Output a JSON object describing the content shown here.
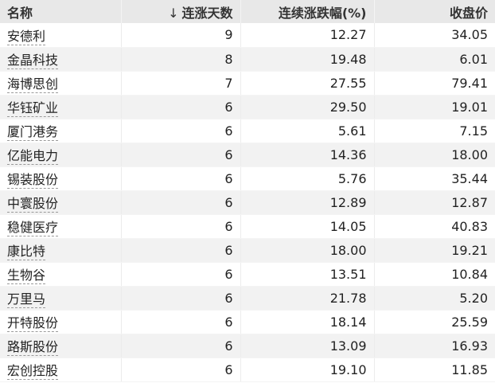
{
  "table": {
    "headers": {
      "name": "名称",
      "days_arrow": "↓",
      "days": "连涨天数",
      "pct": "连续涨跌幅(%)",
      "close": "收盘价"
    },
    "rows": [
      {
        "name": "安德利",
        "days": "9",
        "pct": "12.27",
        "close": "34.05"
      },
      {
        "name": "金晶科技",
        "days": "8",
        "pct": "19.48",
        "close": "6.01"
      },
      {
        "name": "海博思创",
        "days": "7",
        "pct": "27.55",
        "close": "79.41"
      },
      {
        "name": "华钰矿业",
        "days": "6",
        "pct": "29.50",
        "close": "19.01"
      },
      {
        "name": "厦门港务",
        "days": "6",
        "pct": "5.61",
        "close": "7.15"
      },
      {
        "name": "亿能电力",
        "days": "6",
        "pct": "14.36",
        "close": "18.00"
      },
      {
        "name": "锡装股份",
        "days": "6",
        "pct": "5.76",
        "close": "35.44"
      },
      {
        "name": "中寰股份",
        "days": "6",
        "pct": "12.89",
        "close": "12.87"
      },
      {
        "name": "稳健医疗",
        "days": "6",
        "pct": "14.05",
        "close": "40.83"
      },
      {
        "name": "康比特",
        "days": "6",
        "pct": "18.00",
        "close": "19.21"
      },
      {
        "name": "生物谷",
        "days": "6",
        "pct": "13.51",
        "close": "10.84"
      },
      {
        "name": "万里马",
        "days": "6",
        "pct": "21.78",
        "close": "5.20"
      },
      {
        "name": "开特股份",
        "days": "6",
        "pct": "18.14",
        "close": "25.59"
      },
      {
        "name": "路斯股份",
        "days": "6",
        "pct": "13.09",
        "close": "16.93"
      },
      {
        "name": "宏创控股",
        "days": "6",
        "pct": "19.10",
        "close": "11.85"
      }
    ]
  }
}
